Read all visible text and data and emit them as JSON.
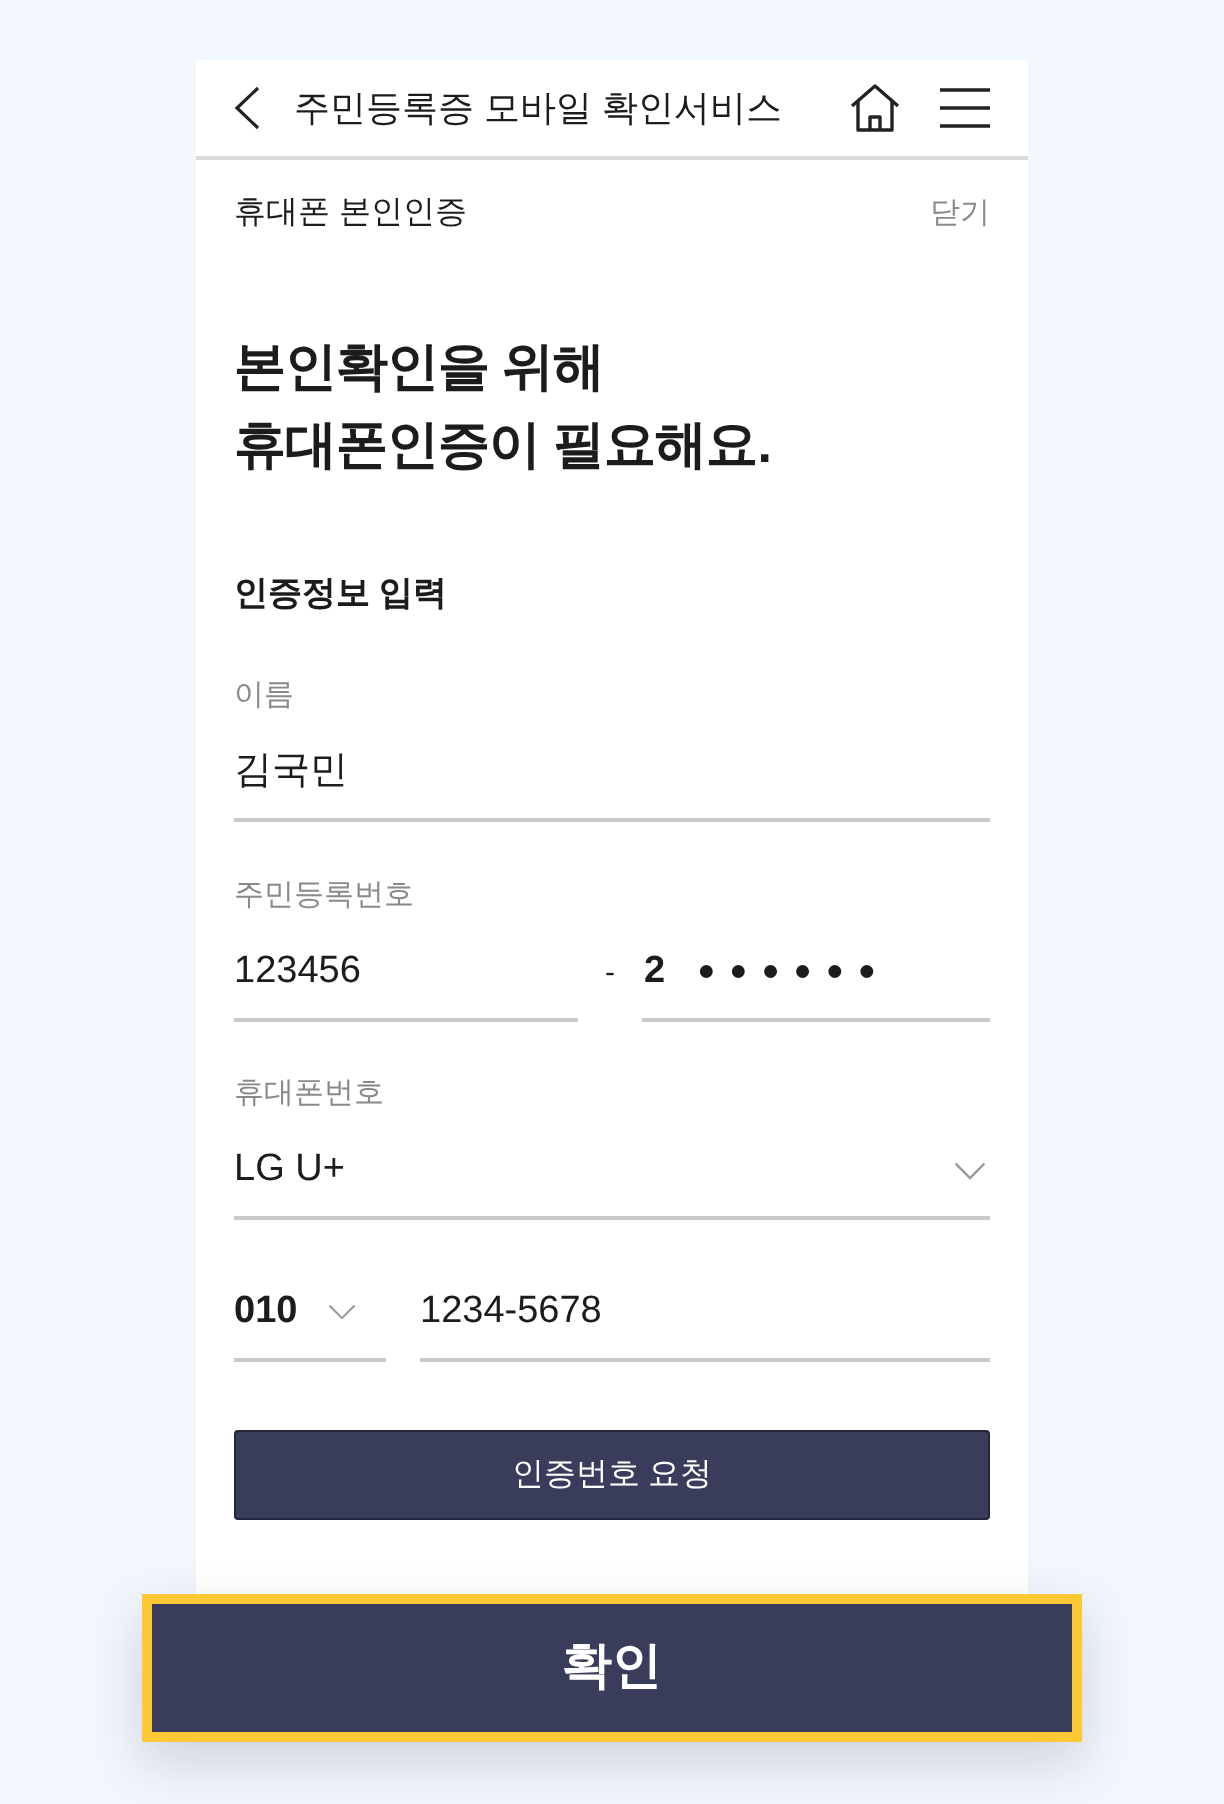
{
  "header": {
    "title": "주민등록증 모바일 확인서비스"
  },
  "sheet": {
    "title": "휴대폰 본인인증",
    "close": "닫기"
  },
  "heading": "본인확인을 위해\n휴대폰인증이 필요해요.",
  "section_title": "인증정보 입력",
  "name_field": {
    "label": "이름",
    "value": "김국민"
  },
  "id_field": {
    "label": "주민등록번호",
    "front": "123456",
    "separator": "-",
    "back_first": "2",
    "back_masked": "●●●●●●"
  },
  "phone_field": {
    "label": "휴대폰번호",
    "carrier": "LG U+",
    "prefix": "010",
    "number": "1234-5678"
  },
  "request_button": {
    "label": "인증번호 요청"
  },
  "confirm_button": {
    "label": "확인",
    "highlighted": true
  }
}
